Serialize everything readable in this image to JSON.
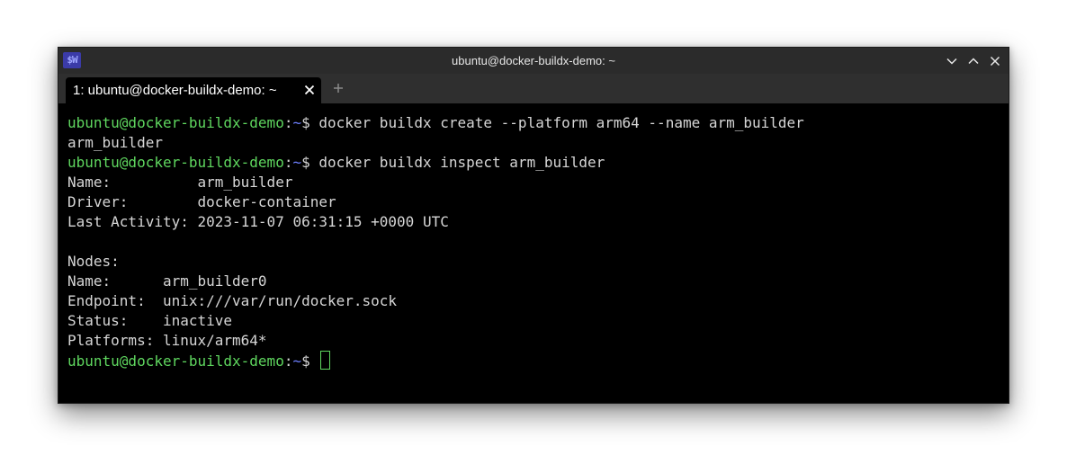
{
  "window": {
    "title": "ubuntu@docker-buildx-demo: ~",
    "app_icon": "$W"
  },
  "tabs": [
    {
      "label": "1: ubuntu@docker-buildx-demo: ~"
    }
  ],
  "colors": {
    "prompt_user": "#5fd75f",
    "prompt_path": "#6d7fff",
    "text": "#d6d6d6",
    "background": "#000000"
  },
  "prompt": {
    "user_host": "ubuntu@docker-buildx-demo",
    "colon": ":",
    "path": "~",
    "dollar": "$ "
  },
  "terminal": {
    "cmd1": "docker buildx create --platform arm64 --name arm_builder",
    "out1": "arm_builder",
    "cmd2": "docker buildx inspect arm_builder",
    "name_line": "Name:          arm_builder",
    "driver_line": "Driver:        docker-container",
    "activity_line": "Last Activity: 2023-11-07 06:31:15 +0000 UTC",
    "blank": "",
    "nodes_line": "Nodes:",
    "node_name_line": "Name:      arm_builder0",
    "endpoint_line": "Endpoint:  unix:///var/run/docker.sock",
    "status_line": "Status:    inactive",
    "platforms_line": "Platforms: linux/arm64*"
  }
}
